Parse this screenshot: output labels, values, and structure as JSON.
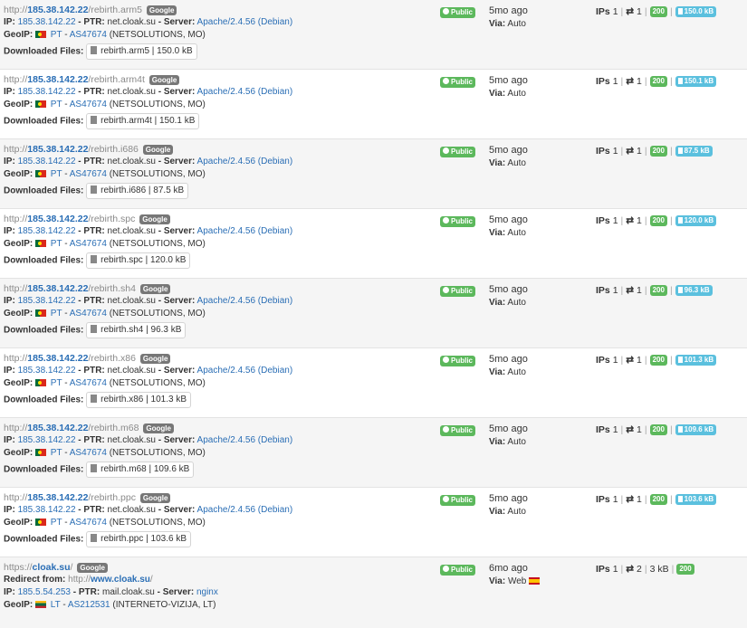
{
  "labels": {
    "google_badge": "Google",
    "ip": "IP:",
    "ptr": "PTR:",
    "server": "Server:",
    "geoip": "GeoIP:",
    "downloaded_files": "Downloaded Files:",
    "redirect_from": "Redirect from:",
    "public_badge": "Public",
    "via": "Via:",
    "ips": "IPs",
    "sep_dash": "-",
    "sep_pipe": "|"
  },
  "rows": [
    {
      "scheme": "http://",
      "host": "185.38.142.22",
      "path": "/rebirth.arm5",
      "ip": "185.38.142.22",
      "ptr": "net.cloak.su",
      "server": "Apache/2.4.56 (Debian)",
      "geo_flag": "portugal-flag",
      "geo_country": "PT",
      "geo_asn": "AS47674",
      "geo_org": "(NETSOLUTIONS, MO)",
      "file": "rebirth.arm5 | 150.0 kB",
      "when": "5mo ago",
      "via": "Auto",
      "ips": "1",
      "swap": "⇄",
      "conns": "1",
      "status": "200",
      "size": "150.0 kB"
    },
    {
      "scheme": "http://",
      "host": "185.38.142.22",
      "path": "/rebirth.arm4t",
      "ip": "185.38.142.22",
      "ptr": "net.cloak.su",
      "server": "Apache/2.4.56 (Debian)",
      "geo_flag": "portugal-flag",
      "geo_country": "PT",
      "geo_asn": "AS47674",
      "geo_org": "(NETSOLUTIONS, MO)",
      "file": "rebirth.arm4t | 150.1 kB",
      "when": "5mo ago",
      "via": "Auto",
      "ips": "1",
      "swap": "⇄",
      "conns": "1",
      "status": "200",
      "size": "150.1 kB"
    },
    {
      "scheme": "http://",
      "host": "185.38.142.22",
      "path": "/rebirth.i686",
      "ip": "185.38.142.22",
      "ptr": "net.cloak.su",
      "server": "Apache/2.4.56 (Debian)",
      "geo_flag": "portugal-flag",
      "geo_country": "PT",
      "geo_asn": "AS47674",
      "geo_org": "(NETSOLUTIONS, MO)",
      "file": "rebirth.i686 | 87.5 kB",
      "when": "5mo ago",
      "via": "Auto",
      "ips": "1",
      "swap": "⇄",
      "conns": "1",
      "status": "200",
      "size": "87.5 kB"
    },
    {
      "scheme": "http://",
      "host": "185.38.142.22",
      "path": "/rebirth.spc",
      "ip": "185.38.142.22",
      "ptr": "net.cloak.su",
      "server": "Apache/2.4.56 (Debian)",
      "geo_flag": "portugal-flag",
      "geo_country": "PT",
      "geo_asn": "AS47674",
      "geo_org": "(NETSOLUTIONS, MO)",
      "file": "rebirth.spc | 120.0 kB",
      "when": "5mo ago",
      "via": "Auto",
      "ips": "1",
      "swap": "⇄",
      "conns": "1",
      "status": "200",
      "size": "120.0 kB"
    },
    {
      "scheme": "http://",
      "host": "185.38.142.22",
      "path": "/rebirth.sh4",
      "ip": "185.38.142.22",
      "ptr": "net.cloak.su",
      "server": "Apache/2.4.56 (Debian)",
      "geo_flag": "portugal-flag",
      "geo_country": "PT",
      "geo_asn": "AS47674",
      "geo_org": "(NETSOLUTIONS, MO)",
      "file": "rebirth.sh4 | 96.3 kB",
      "when": "5mo ago",
      "via": "Auto",
      "ips": "1",
      "swap": "⇄",
      "conns": "1",
      "status": "200",
      "size": "96.3 kB"
    },
    {
      "scheme": "http://",
      "host": "185.38.142.22",
      "path": "/rebirth.x86",
      "ip": "185.38.142.22",
      "ptr": "net.cloak.su",
      "server": "Apache/2.4.56 (Debian)",
      "geo_flag": "portugal-flag",
      "geo_country": "PT",
      "geo_asn": "AS47674",
      "geo_org": "(NETSOLUTIONS, MO)",
      "file": "rebirth.x86 | 101.3 kB",
      "when": "5mo ago",
      "via": "Auto",
      "ips": "1",
      "swap": "⇄",
      "conns": "1",
      "status": "200",
      "size": "101.3 kB"
    },
    {
      "scheme": "http://",
      "host": "185.38.142.22",
      "path": "/rebirth.m68",
      "ip": "185.38.142.22",
      "ptr": "net.cloak.su",
      "server": "Apache/2.4.56 (Debian)",
      "geo_flag": "portugal-flag",
      "geo_country": "PT",
      "geo_asn": "AS47674",
      "geo_org": "(NETSOLUTIONS, MO)",
      "file": "rebirth.m68 | 109.6 kB",
      "when": "5mo ago",
      "via": "Auto",
      "ips": "1",
      "swap": "⇄",
      "conns": "1",
      "status": "200",
      "size": "109.6 kB"
    },
    {
      "scheme": "http://",
      "host": "185.38.142.22",
      "path": "/rebirth.ppc",
      "ip": "185.38.142.22",
      "ptr": "net.cloak.su",
      "server": "Apache/2.4.56 (Debian)",
      "geo_flag": "portugal-flag",
      "geo_country": "PT",
      "geo_asn": "AS47674",
      "geo_org": "(NETSOLUTIONS, MO)",
      "file": "rebirth.ppc | 103.6 kB",
      "when": "5mo ago",
      "via": "Auto",
      "ips": "1",
      "swap": "⇄",
      "conns": "1",
      "status": "200",
      "size": "103.6 kB"
    }
  ],
  "last_row": {
    "scheme": "https://",
    "host": "cloak.su",
    "path": "/",
    "redirect_scheme": "http://",
    "redirect_host": "www.cloak.su",
    "redirect_path": "/",
    "ip": "185.5.54.253",
    "ptr": "mail.cloak.su",
    "server": "nginx",
    "geo_flag": "lithuania-flag",
    "geo_country": "LT",
    "geo_asn": "AS212531",
    "geo_org": "(INTERNETO-VIZIJA, LT)",
    "when": "6mo ago",
    "via": "Web",
    "via_flag": "spain-flag",
    "ips": "1",
    "swap": "⇄",
    "conns": "2",
    "size": "3 kB",
    "status": "200"
  },
  "colors": {
    "link": "#2a6eb5",
    "public_badge": "#5cb85c",
    "status_badge": "#5cb85c",
    "size_badge": "#5bc0de",
    "google_badge": "#777777"
  }
}
